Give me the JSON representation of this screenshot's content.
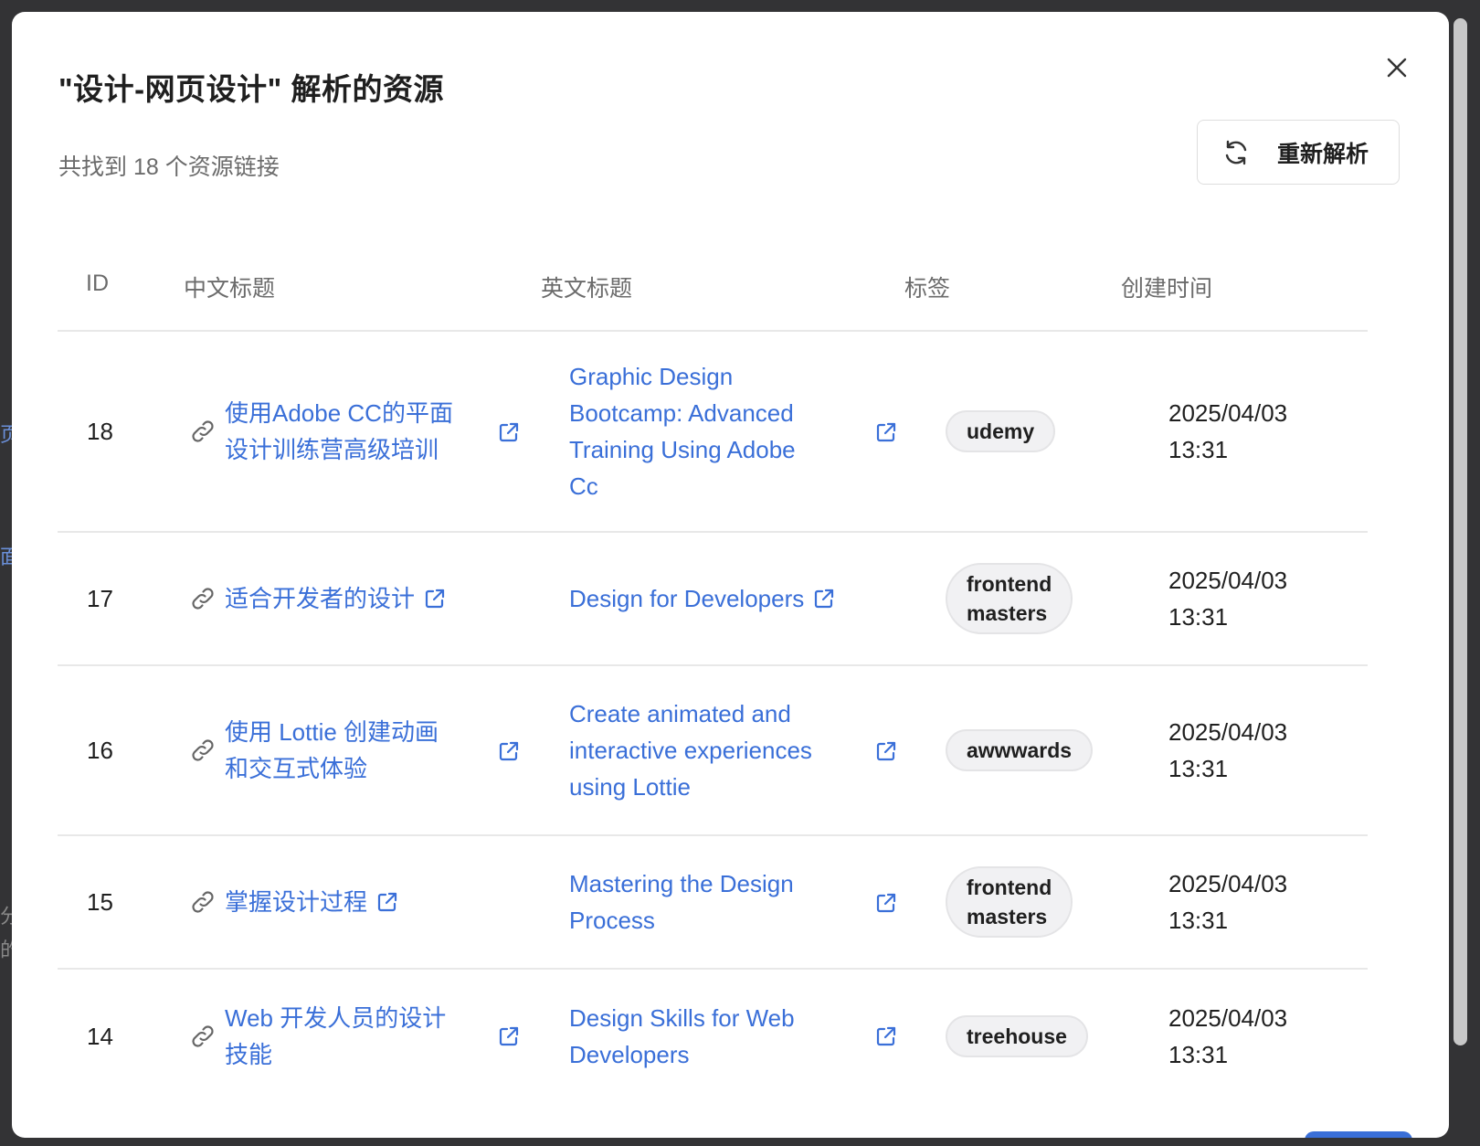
{
  "dialog": {
    "title": "\"设计-网页设计\" 解析的资源",
    "summary": "共找到 18 个资源链接",
    "refresh_label": "重新解析"
  },
  "table": {
    "headers": {
      "id": "ID",
      "cn_title": "中文标题",
      "en_title": "英文标题",
      "tags": "标签",
      "created": "创建时间"
    },
    "rows": [
      {
        "id": "18",
        "cn_lines": [
          "使用Adobe CC的平面",
          "设计训练营高级培训"
        ],
        "en_lines": [
          "Graphic Design",
          "Bootcamp: Advanced",
          "Training Using Adobe",
          "Cc"
        ],
        "tag_lines": [
          "udemy"
        ],
        "date": "2025/04/03",
        "time": "13:31"
      },
      {
        "id": "17",
        "cn_lines": [
          "适合开发者的设计"
        ],
        "en_lines": [
          "Design for Developers"
        ],
        "tag_lines": [
          "frontend",
          "masters"
        ],
        "date": "2025/04/03",
        "time": "13:31"
      },
      {
        "id": "16",
        "cn_lines": [
          "使用 Lottie 创建动画",
          "和交互式体验"
        ],
        "en_lines": [
          "Create animated and",
          "interactive experiences",
          "using Lottie"
        ],
        "tag_lines": [
          "awwwards"
        ],
        "date": "2025/04/03",
        "time": "13:31"
      },
      {
        "id": "15",
        "cn_lines": [
          "掌握设计过程"
        ],
        "en_lines": [
          "Mastering the Design",
          "Process"
        ],
        "tag_lines": [
          "frontend",
          "masters"
        ],
        "date": "2025/04/03",
        "time": "13:31"
      },
      {
        "id": "14",
        "cn_lines": [
          "Web 开发人员的设计",
          "技能"
        ],
        "en_lines": [
          "Design Skills for Web",
          "Developers"
        ],
        "tag_lines": [
          "treehouse"
        ],
        "date": "2025/04/03",
        "time": "13:31"
      }
    ]
  },
  "colors": {
    "link": "#3a6fd8",
    "primary": "#3a6fd8",
    "tag_bg": "#f1f1f3"
  },
  "icons": {
    "close": "close-icon",
    "refresh": "refresh-icon",
    "link": "link-icon",
    "external": "external-link-icon"
  }
}
